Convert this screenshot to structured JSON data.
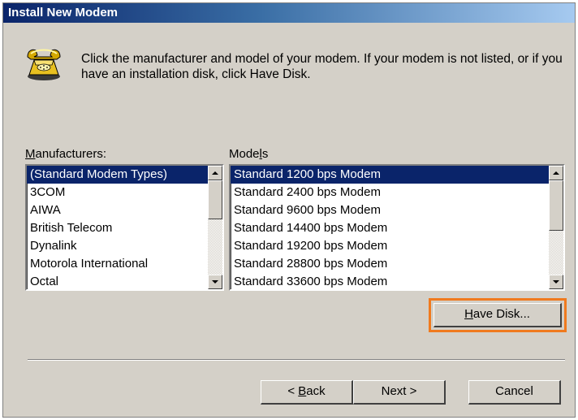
{
  "window": {
    "title": "Install New Modem"
  },
  "instructions": "Click the manufacturer and model of your modem. If your modem is not listed, or if you have an installation disk, click Have Disk.",
  "manufacturers": {
    "label_pre": "",
    "label_key": "M",
    "label_post": "anufacturers:",
    "items": [
      "(Standard Modem Types)",
      "3COM",
      "AIWA",
      "British Telecom",
      "Dynalink",
      "Motorola International",
      "Octal"
    ],
    "selected_index": 0
  },
  "models": {
    "label_pre": "Mode",
    "label_key": "l",
    "label_post": "s",
    "items": [
      "Standard  1200 bps Modem",
      "Standard  2400 bps Modem",
      "Standard  9600 bps Modem",
      "Standard 14400 bps Modem",
      "Standard 19200 bps Modem",
      "Standard 28800 bps Modem",
      "Standard 33600 bps Modem"
    ],
    "selected_index": 0
  },
  "buttons": {
    "have_disk": {
      "key": "H",
      "rest": "ave Disk..."
    },
    "back": {
      "pre": "< ",
      "key": "B",
      "rest": "ack"
    },
    "next": "Next >",
    "cancel": "Cancel"
  },
  "highlight_color": "#f07a1e",
  "icons": [
    "telephone-icon",
    "scroll-up-arrow-icon",
    "scroll-down-arrow-icon"
  ]
}
